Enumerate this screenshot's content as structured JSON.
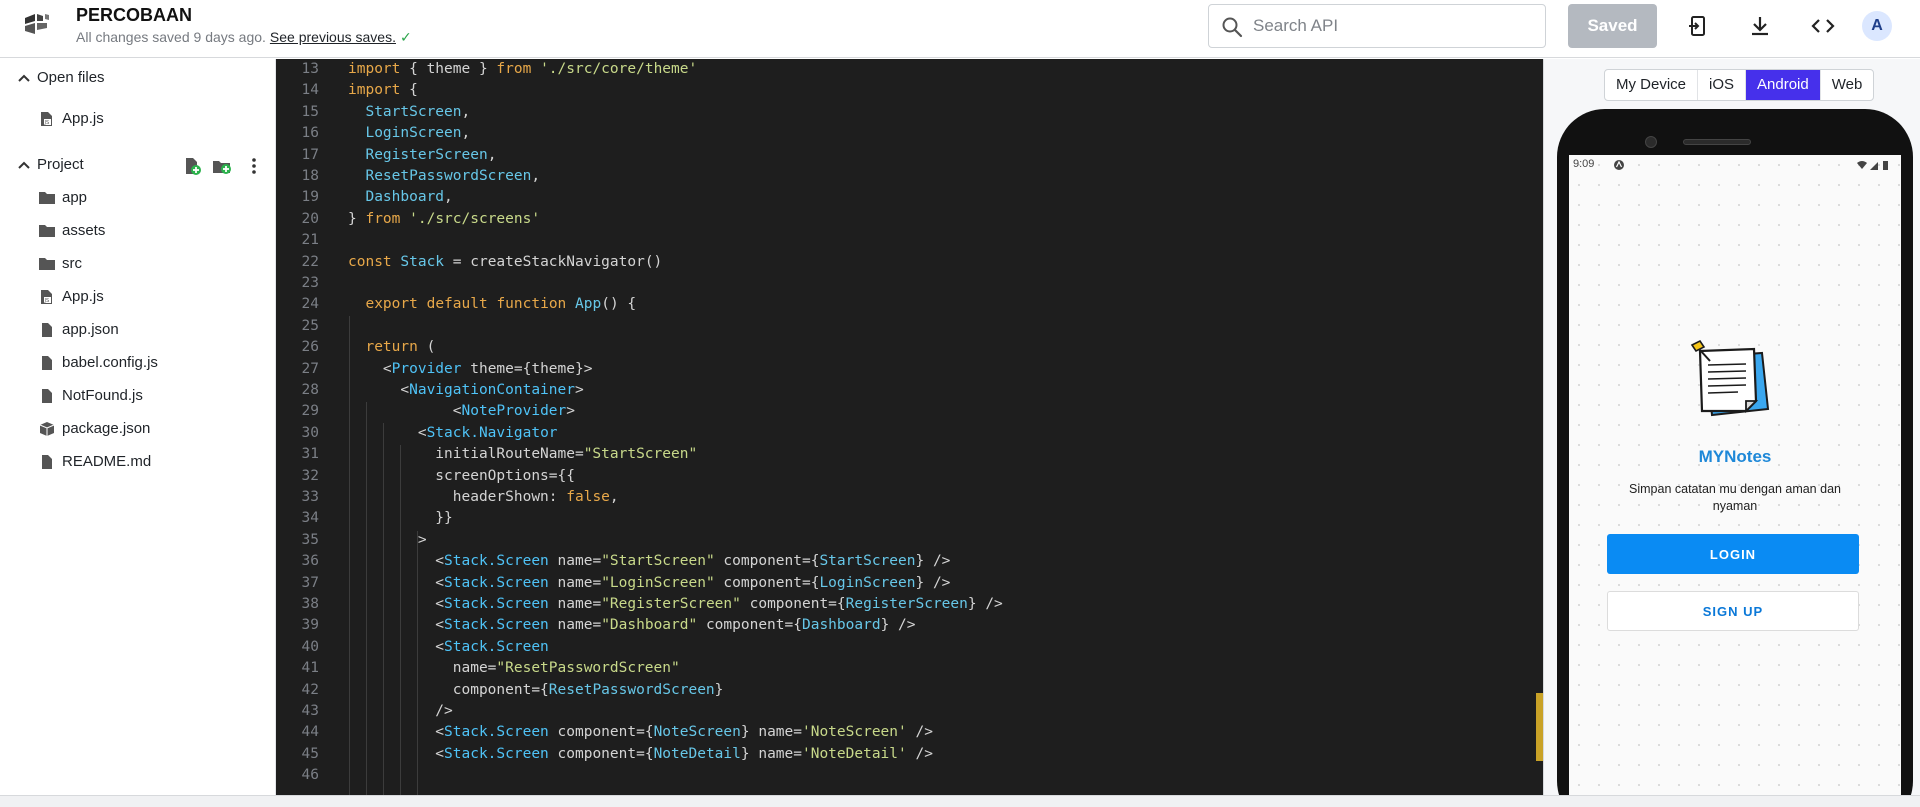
{
  "header": {
    "project_title": "PERCOBAAN",
    "save_status": "All changes saved 9 days ago.",
    "previous_saves_link": "See previous saves.",
    "check_glyph": "✓",
    "search_placeholder": "Search API",
    "saved_button": "Saved",
    "avatar_initial": "A",
    "icons": [
      "expo-logo-icon",
      "search-icon",
      "device-import-icon",
      "download-icon",
      "code-icon"
    ]
  },
  "sidebar": {
    "open_files": {
      "label": "Open files",
      "items": [
        {
          "label": "App.js",
          "icon": "js-file-icon"
        }
      ]
    },
    "project": {
      "label": "Project",
      "actions": [
        "new-file-icon",
        "new-folder-icon",
        "more-vertical-icon"
      ],
      "items": [
        {
          "label": "app",
          "icon": "folder-icon"
        },
        {
          "label": "assets",
          "icon": "folder-icon"
        },
        {
          "label": "src",
          "icon": "folder-icon"
        },
        {
          "label": "App.js",
          "icon": "js-file-icon"
        },
        {
          "label": "app.json",
          "icon": "file-icon"
        },
        {
          "label": "babel.config.js",
          "icon": "file-icon"
        },
        {
          "label": "NotFound.js",
          "icon": "file-icon"
        },
        {
          "label": "package.json",
          "icon": "package-icon"
        },
        {
          "label": "README.md",
          "icon": "file-icon"
        }
      ]
    }
  },
  "editor": {
    "lines": [
      {
        "n": "13",
        "text": "import { theme } from './src/core/theme'"
      },
      {
        "n": "14",
        "text": "import {"
      },
      {
        "n": "15",
        "text": "  StartScreen,"
      },
      {
        "n": "16",
        "text": "  LoginScreen,"
      },
      {
        "n": "17",
        "text": "  RegisterScreen,"
      },
      {
        "n": "18",
        "text": "  ResetPasswordScreen,"
      },
      {
        "n": "19",
        "text": "  Dashboard,"
      },
      {
        "n": "20",
        "text": "} from './src/screens'"
      },
      {
        "n": "21",
        "text": ""
      },
      {
        "n": "22",
        "text": "const Stack = createStackNavigator()"
      },
      {
        "n": "23",
        "text": ""
      },
      {
        "n": "24",
        "text": "  export default function App() {"
      },
      {
        "n": "25",
        "text": ""
      },
      {
        "n": "26",
        "text": "  return ("
      },
      {
        "n": "27",
        "text": "    <Provider theme={theme}>"
      },
      {
        "n": "28",
        "text": "      <NavigationContainer>"
      },
      {
        "n": "29",
        "text": "            <NoteProvider>"
      },
      {
        "n": "30",
        "text": "        <Stack.Navigator"
      },
      {
        "n": "31",
        "text": "          initialRouteName=\"StartScreen\""
      },
      {
        "n": "32",
        "text": "          screenOptions={{"
      },
      {
        "n": "33",
        "text": "            headerShown: false,"
      },
      {
        "n": "34",
        "text": "          }}"
      },
      {
        "n": "35",
        "text": "        >"
      },
      {
        "n": "36",
        "text": "          <Stack.Screen name=\"StartScreen\" component={StartScreen} />"
      },
      {
        "n": "37",
        "text": "          <Stack.Screen name=\"LoginScreen\" component={LoginScreen} />"
      },
      {
        "n": "38",
        "text": "          <Stack.Screen name=\"RegisterScreen\" component={RegisterScreen} />"
      },
      {
        "n": "39",
        "text": "          <Stack.Screen name=\"Dashboard\" component={Dashboard} />"
      },
      {
        "n": "40",
        "text": "          <Stack.Screen"
      },
      {
        "n": "41",
        "text": "            name=\"ResetPasswordScreen\""
      },
      {
        "n": "42",
        "text": "            component={ResetPasswordScreen}"
      },
      {
        "n": "43",
        "text": "          />"
      },
      {
        "n": "44",
        "text": "          <Stack.Screen component={NoteScreen} name='NoteScreen' />"
      },
      {
        "n": "45",
        "text": "          <Stack.Screen component={NoteDetail} name='NoteDetail' />"
      },
      {
        "n": "46",
        "text": ""
      }
    ]
  },
  "preview": {
    "platforms": [
      "My Device",
      "iOS",
      "Android",
      "Web"
    ],
    "active_platform": "Android",
    "device": {
      "time": "9:09",
      "app_name": "MYNotes",
      "tagline": "Simpan catatan mu dengan aman dan nyaman",
      "login_button": "LOGIN",
      "signup_button": "SIGN UP"
    }
  },
  "colors": {
    "accent": "#4630eb",
    "editor_bg": "#1e1e1e",
    "keyword": "#e8a849",
    "string": "#c8d98a",
    "component": "#4fc3f7",
    "app_name": "#1e88d8",
    "login_button": "#0a8bf3"
  }
}
